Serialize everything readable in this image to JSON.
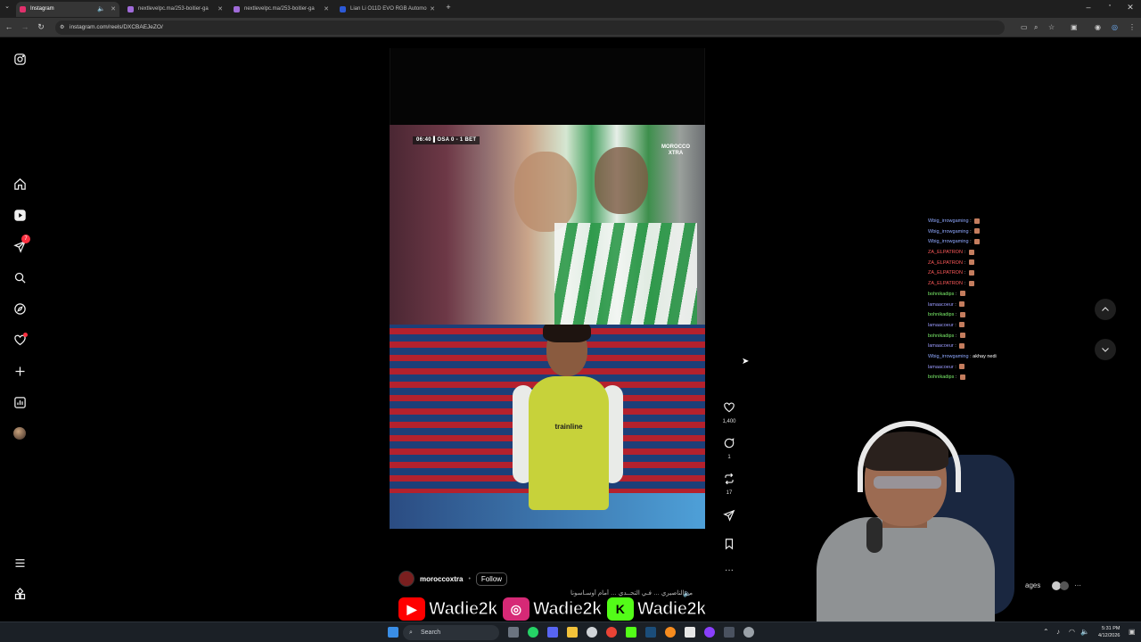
{
  "browser": {
    "tabs": [
      {
        "label": "Instagram",
        "active": true,
        "favicon_color": "#e1306c"
      },
      {
        "label": "nextlevelpc.ma/253-boitier-ga",
        "active": false,
        "favicon_color": "#a06bd9"
      },
      {
        "label": "nextlevelpc.ma/253-boitier-ga",
        "active": false,
        "favicon_color": "#a06bd9"
      },
      {
        "label": "Lian Li O11D EVO RGB Automo",
        "active": false,
        "favicon_color": "#2c59d6"
      }
    ],
    "new_tab": "+",
    "url": "instagram.com/reels/DXCBAEJeZO/"
  },
  "instagram": {
    "nav_icons": [
      "instagram-logo-icon",
      "home-icon",
      "reels-icon",
      "messages-icon",
      "search-icon",
      "explore-icon",
      "notifications-icon",
      "create-icon",
      "dashboard-icon",
      "profile-avatar",
      "more-menu-icon",
      "also-from-meta-icon"
    ],
    "messages_badge": "7",
    "reel": {
      "scorebug": "06:40 ▌OSA 0 - 1 BET",
      "channel_watermark": "MOROCCO XTRA",
      "jersey_sponsor": "trainline",
      "author": "moroccoxtra",
      "follow_label": "Follow",
      "caption": "مد الناصيري … فـي التحــدي … أمام أوسـاسونا"
    },
    "actions": {
      "likes": "1,400",
      "comments": "1",
      "reposts": "17"
    }
  },
  "chat": [
    {
      "user": "Wbig_irrowgaming",
      "msg": "",
      "color": "#8fa8ff"
    },
    {
      "user": "Wbig_irrowgaming",
      "msg": "",
      "color": "#8fa8ff"
    },
    {
      "user": "Wbig_irrowgaming",
      "msg": "",
      "color": "#8fa8ff"
    },
    {
      "user": "ZA_ELPATRON",
      "msg": "",
      "color": "#ff5a5a"
    },
    {
      "user": "ZA_ELPATRON",
      "msg": "",
      "color": "#ff5a5a"
    },
    {
      "user": "ZA_ELPATRON",
      "msg": "",
      "color": "#ff5a5a"
    },
    {
      "user": "ZA_ELPATRON",
      "msg": "",
      "color": "#ff5a5a"
    },
    {
      "user": "bohnikadips",
      "msg": "",
      "color": "#7cf06b"
    },
    {
      "user": "lamaacoeur",
      "msg": "",
      "color": "#9b9bff"
    },
    {
      "user": "bohnikadips",
      "msg": "",
      "color": "#7cf06b"
    },
    {
      "user": "lamaacoeur",
      "msg": "",
      "color": "#9b9bff"
    },
    {
      "user": "bohnikadips",
      "msg": "",
      "color": "#7cf06b"
    },
    {
      "user": "lamaacoeur",
      "msg": "",
      "color": "#9b9bff"
    },
    {
      "user": "Wbig_irrowgaming",
      "msg": "akhay nedi",
      "color": "#8fa8ff"
    },
    {
      "user": "lamaacoeur",
      "msg": "",
      "color": "#9b9bff"
    },
    {
      "user": "bohnikadips",
      "msg": "",
      "color": "#7cf06b"
    }
  ],
  "webcam_overlay": {
    "messages_label": "ages"
  },
  "socials": [
    {
      "platform": "youtube-icon",
      "name": "Wadie2k",
      "color": "#ff0000"
    },
    {
      "platform": "instagram-icon",
      "name": "Wadie2k",
      "color": "#d62976"
    },
    {
      "platform": "kick-icon",
      "name": "Wadie2k",
      "color": "#53fc18"
    }
  ],
  "taskbar": {
    "search_placeholder": "Search",
    "time": "5:31 PM",
    "date": "4/12/2026"
  }
}
